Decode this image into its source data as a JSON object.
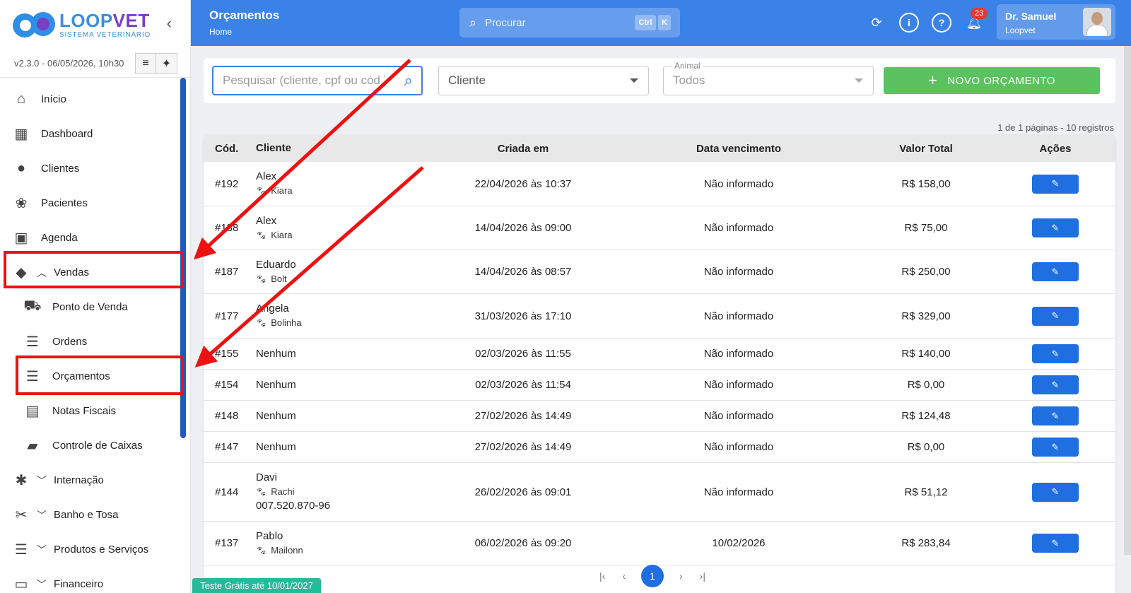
{
  "app": {
    "logo_name_a": "LOOP",
    "logo_name_b": "VET",
    "logo_sub": "SISTEMA VETERINÁRIO",
    "version": "v2.3.0 - 06/05/2026, 10h30"
  },
  "sidebar": {
    "items": [
      {
        "label": "Início",
        "icon": "home-icon"
      },
      {
        "label": "Dashboard",
        "icon": "dashboard-icon"
      },
      {
        "label": "Clientes",
        "icon": "person-icon"
      },
      {
        "label": "Pacientes",
        "icon": "paw-icon"
      },
      {
        "label": "Agenda",
        "icon": "calendar-icon"
      },
      {
        "label": "Vendas",
        "icon": "tag-icon"
      },
      {
        "label": "Ponto de Venda",
        "icon": "cart-icon"
      },
      {
        "label": "Ordens",
        "icon": "list-icon"
      },
      {
        "label": "Orçamentos",
        "icon": "list-icon"
      },
      {
        "label": "Notas Fiscais",
        "icon": "document-icon"
      },
      {
        "label": "Controle de Caixas",
        "icon": "briefcase-icon"
      },
      {
        "label": "Internação",
        "icon": "asterisk-icon"
      },
      {
        "label": "Banho e Tosa",
        "icon": "scissors-icon"
      },
      {
        "label": "Produtos e Serviços",
        "icon": "list-icon"
      },
      {
        "label": "Financeiro",
        "icon": "money-icon"
      }
    ]
  },
  "header": {
    "title": "Orçamentos",
    "breadcrumb": "Home",
    "search_placeholder": "Procurar",
    "kbd_ctrl": "Ctrl",
    "kbd_k": "K",
    "notif_count": "23",
    "user_name": "Dr. Samuel",
    "user_org": "Loopvet"
  },
  "filters": {
    "search_placeholder": "Pesquisar (cliente, cpf ou cód.)",
    "client_label": "Cliente",
    "animal_label": "Animal",
    "animal_value": "Todos",
    "new_button": "NOVO ORÇAMENTO"
  },
  "page_info": "1 de 1 páginas - 10 registros",
  "table": {
    "headers": [
      "Cód.",
      "Cliente",
      "Criada em",
      "Data vencimento",
      "Valor Total",
      "Ações"
    ],
    "rows": [
      {
        "cod": "#192",
        "cliente": "Alex",
        "pet": "Kiara",
        "doc": "",
        "criada": "22/04/2026 às 10:37",
        "venc": "Não informado",
        "valor": "R$ 158,00"
      },
      {
        "cod": "#188",
        "cliente": "Alex",
        "pet": "Kiara",
        "doc": "",
        "criada": "14/04/2026 às 09:00",
        "venc": "Não informado",
        "valor": "R$ 75,00"
      },
      {
        "cod": "#187",
        "cliente": "Eduardo",
        "pet": "Bolt",
        "doc": "",
        "criada": "14/04/2026 às 08:57",
        "venc": "Não informado",
        "valor": "R$ 250,00"
      },
      {
        "cod": "#177",
        "cliente": "Angela",
        "pet": "Bolinha",
        "doc": "",
        "criada": "31/03/2026 às 17:10",
        "venc": "Não informado",
        "valor": "R$ 329,00"
      },
      {
        "cod": "#155",
        "cliente": "Nenhum",
        "pet": "",
        "doc": "",
        "criada": "02/03/2026 às 11:55",
        "venc": "Não informado",
        "valor": "R$ 140,00"
      },
      {
        "cod": "#154",
        "cliente": "Nenhum",
        "pet": "",
        "doc": "",
        "criada": "02/03/2026 às 11:54",
        "venc": "Não informado",
        "valor": "R$ 0,00"
      },
      {
        "cod": "#148",
        "cliente": "Nenhum",
        "pet": "",
        "doc": "",
        "criada": "27/02/2026 às 14:49",
        "venc": "Não informado",
        "valor": "R$ 124,48"
      },
      {
        "cod": "#147",
        "cliente": "Nenhum",
        "pet": "",
        "doc": "",
        "criada": "27/02/2026 às 14:49",
        "venc": "Não informado",
        "valor": "R$ 0,00"
      },
      {
        "cod": "#144",
        "cliente": "Davi",
        "pet": "Rachi",
        "doc": "007.520.870-96",
        "criada": "26/02/2026 às 09:01",
        "venc": "Não informado",
        "valor": "R$ 51,12"
      },
      {
        "cod": "#137",
        "cliente": "Pablo",
        "pet": "Mailonn",
        "doc": "",
        "criada": "06/02/2026 às 09:20",
        "venc": "10/02/2026",
        "valor": "R$ 283,84"
      }
    ]
  },
  "pager": {
    "current": "1"
  },
  "trial": "Teste Grátis até 10/01/2027",
  "colors": {
    "primary": "#3b82e8",
    "success": "#5ac25e",
    "highlight": "#ee1111",
    "trial": "#28b99a"
  }
}
